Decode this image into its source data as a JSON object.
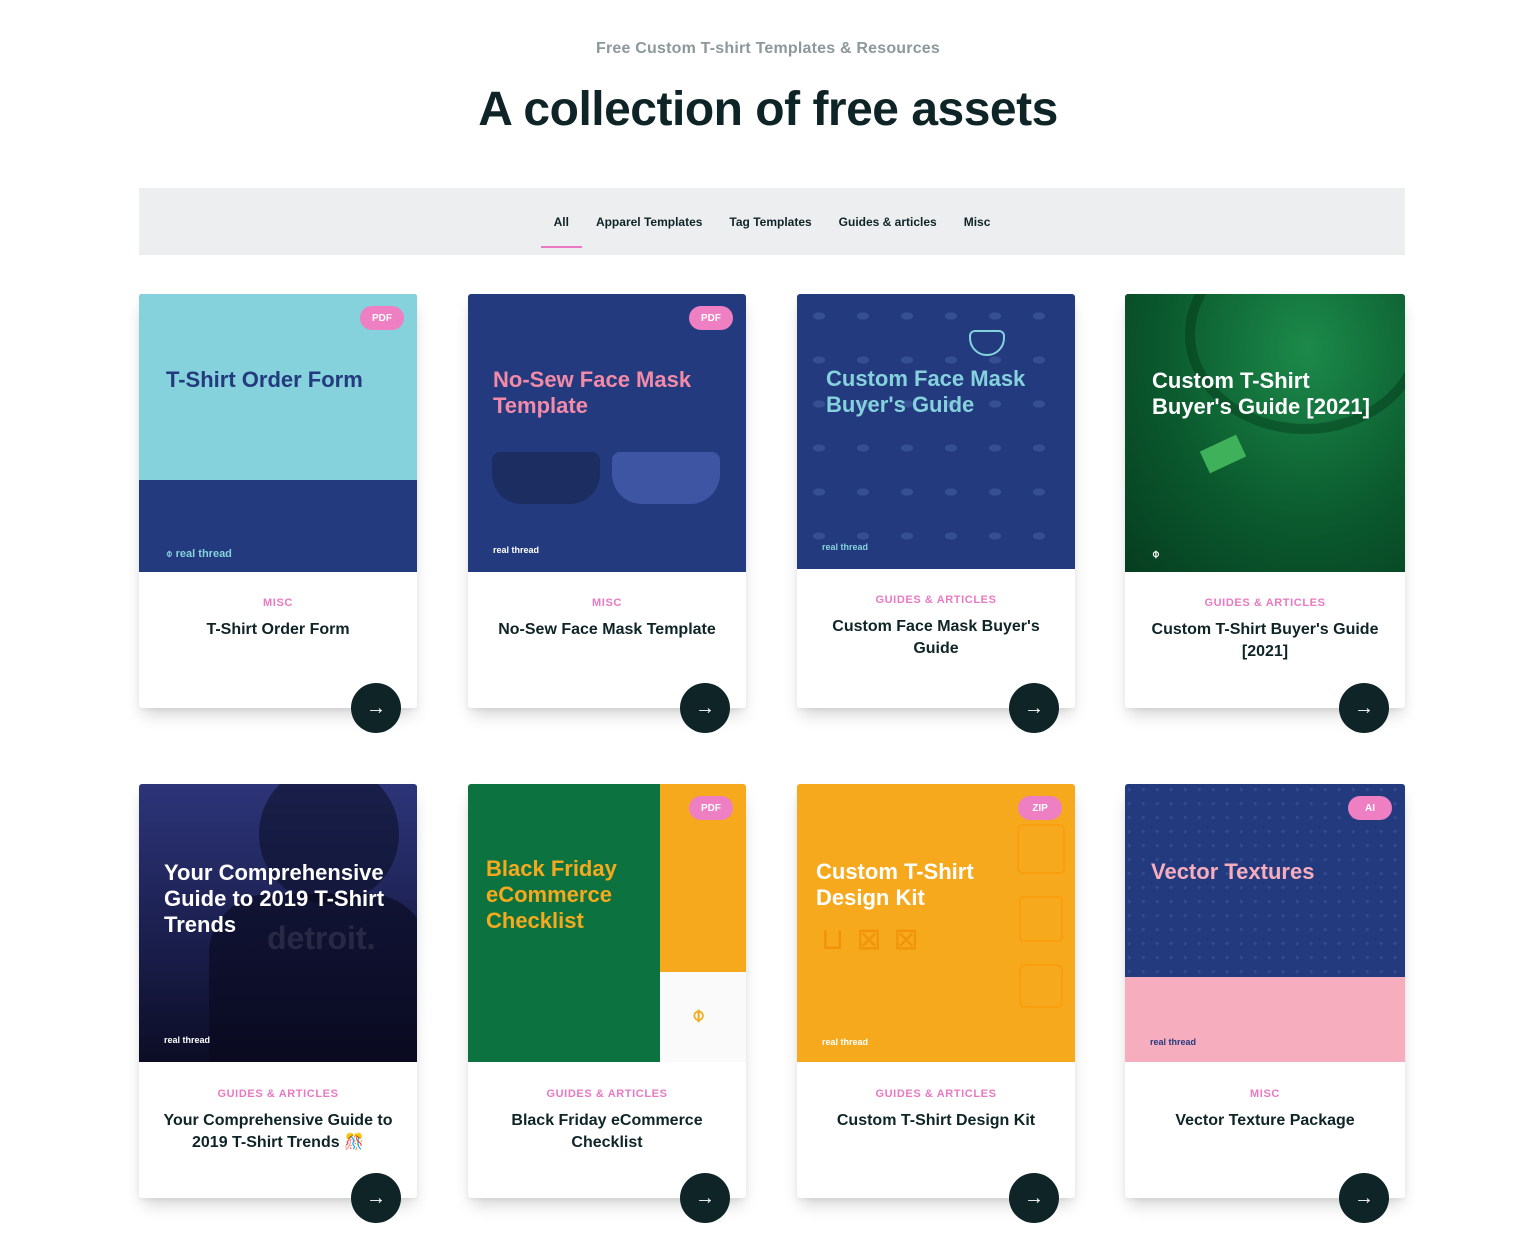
{
  "header": {
    "eyebrow": "Free Custom T-shirt Templates & Resources",
    "headline": "A collection of free assets"
  },
  "filters": [
    {
      "label": "All",
      "active": true
    },
    {
      "label": "Apparel Templates",
      "active": false
    },
    {
      "label": "Tag Templates",
      "active": false
    },
    {
      "label": "Guides & articles",
      "active": false
    },
    {
      "label": "Misc",
      "active": false
    }
  ],
  "cards": [
    {
      "category": "MISC",
      "title": "T-Shirt Order Form",
      "thumb_title": "T-Shirt Order Form",
      "badge": "PDF",
      "logo": "real thread"
    },
    {
      "category": "MISC",
      "title": "No-Sew Face Mask Template",
      "thumb_title": "No-Sew Face Mask Template",
      "badge": "PDF",
      "logo": "real thread"
    },
    {
      "category": "GUIDES & ARTICLES",
      "title": "Custom Face Mask Buyer's Guide",
      "thumb_title": "Custom Face Mask Buyer's Guide",
      "badge": "",
      "logo": "real thread"
    },
    {
      "category": "GUIDES & ARTICLES",
      "title": "Custom T-Shirt Buyer's Guide [2021]",
      "thumb_title": "Custom T-Shirt Buyer's Guide [2021]",
      "badge": "",
      "logo": ""
    },
    {
      "category": "GUIDES & ARTICLES",
      "title": "Your Comprehensive Guide to 2019 T-Shirt Trends 🎊",
      "thumb_title": "Your Comprehensive Guide to 2019 T-Shirt Trends",
      "badge": "",
      "logo": "real thread",
      "watermark": "detroit."
    },
    {
      "category": "GUIDES & ARTICLES",
      "title": "Black Friday eCommerce Checklist",
      "thumb_title": "Black Friday eCommerce Checklist",
      "badge": "PDF",
      "logo": ""
    },
    {
      "category": "GUIDES & ARTICLES",
      "title": "Custom T-Shirt Design Kit",
      "thumb_title": "Custom T-Shirt Design Kit",
      "badge": "ZIP",
      "logo": "real thread"
    },
    {
      "category": "MISC",
      "title": "Vector Texture Package",
      "thumb_title": "Vector Textures",
      "badge": "AI",
      "logo": "real thread"
    }
  ],
  "arrow_icon": "arrow-right-icon",
  "colors": {
    "accent_pink": "#e879c2",
    "dark": "#0f2427",
    "navy": "#243a7e",
    "teal": "#85d2dc",
    "green": "#0c6b3a",
    "orange": "#f6a91d"
  }
}
